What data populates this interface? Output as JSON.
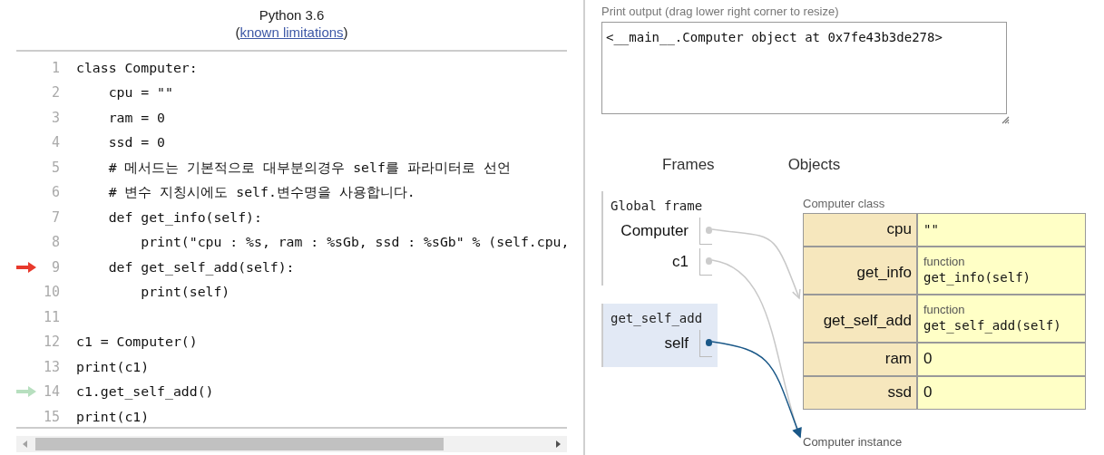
{
  "header": {
    "title": "Python 3.6",
    "link_prefix": "(",
    "link": "known limitations",
    "link_suffix": ")"
  },
  "code": [
    {
      "number": "1",
      "text": "class Computer:"
    },
    {
      "number": "2",
      "text": "    cpu = \"\""
    },
    {
      "number": "3",
      "text": "    ram = 0"
    },
    {
      "number": "4",
      "text": "    ssd = 0"
    },
    {
      "number": "5",
      "text": "    # 메서드는 기본적으로 대부분의경우 self를 파라미터로 선언"
    },
    {
      "number": "6",
      "text": "    # 변수 지칭시에도 self.변수명을 사용합니다."
    },
    {
      "number": "7",
      "text": "    def get_info(self):"
    },
    {
      "number": "8",
      "text": "        print(\"cpu : %s, ram : %sGb, ssd : %sGb\" % (self.cpu,"
    },
    {
      "number": "9",
      "text": "    def get_self_add(self):",
      "current_line": true
    },
    {
      "number": "10",
      "text": "        print(self)"
    },
    {
      "number": "11"
    },
    {
      "number": "12",
      "text": "c1 = Computer()"
    },
    {
      "number": "13",
      "text": "print(c1)"
    },
    {
      "number": "14",
      "text": "c1.get_self_add()",
      "next_line": true
    },
    {
      "number": "15",
      "text": "print(c1)"
    }
  ],
  "print_output": {
    "label": "Print output (drag lower right corner to resize)",
    "text": "<__main__.Computer object at 0x7fe43b3de278>"
  },
  "headings": [
    "Frames",
    "Objects"
  ],
  "frames": [
    {
      "name": "Global frame",
      "selected": false,
      "variables": [
        {
          "name": "Computer",
          "points_to_class": true
        },
        {
          "name": "c1",
          "points_to_class": false
        }
      ]
    },
    {
      "name": "get_self_add",
      "selected": true,
      "variables": [
        {
          "name": "self",
          "points_to_class": false
        }
      ]
    }
  ],
  "class_object": {
    "label": "Computer class",
    "fields": [
      {
        "name": "cpu",
        "value": "\"\""
      },
      {
        "name": "get_info",
        "type_label": "function",
        "value": "get_info(self)"
      },
      {
        "name": "get_self_add",
        "type_label": "function",
        "value": "get_self_add(self)"
      },
      {
        "name": "ram",
        "value": "0"
      },
      {
        "name": "ssd",
        "value": "0"
      }
    ]
  },
  "instance_object": {
    "label": "Computer instance"
  }
}
